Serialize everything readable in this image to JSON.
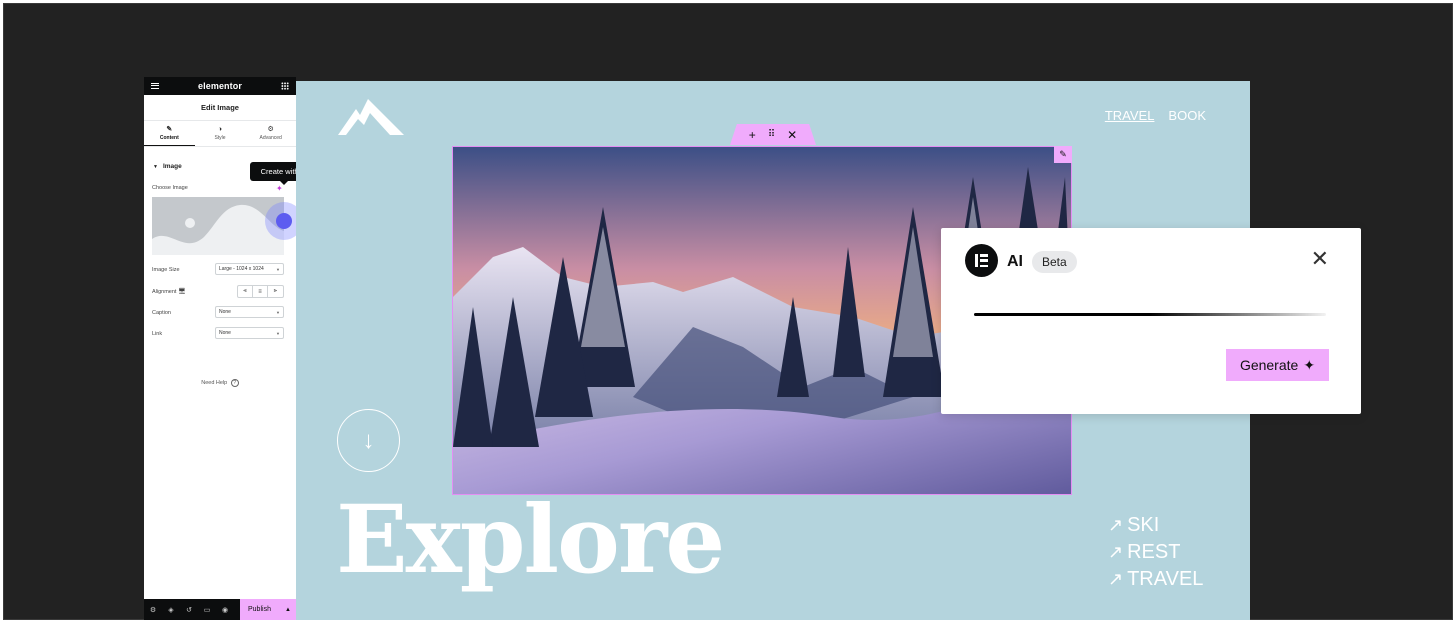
{
  "editor": {
    "brand": "elementor",
    "panel_title": "Edit Image",
    "tabs": [
      {
        "label": "Content",
        "icon": "pencil-icon"
      },
      {
        "label": "Style",
        "icon": "half-circle-icon"
      },
      {
        "label": "Advanced",
        "icon": "gear-icon"
      }
    ],
    "section_title": "Image",
    "choose_image_label": "Choose Image",
    "tooltip": "Create with AI",
    "image_size_label": "Image Size",
    "image_size_value": "Large - 1024 x 1024",
    "alignment_label": "Alignment",
    "caption_label": "Caption",
    "caption_value": "None",
    "link_label": "Link",
    "link_value": "None",
    "need_help": "Need Help",
    "publish_label": "Publish"
  },
  "site": {
    "nav": [
      "TRAVEL",
      "BOOK"
    ],
    "headline": "Explore",
    "links": [
      "SKI",
      "REST",
      "TRAVEL"
    ]
  },
  "ai_panel": {
    "title": "AI",
    "badge": "Beta",
    "generate_label": "Generate"
  },
  "colors": {
    "accent": "#f0abfc",
    "canvas_bg": "#b4d4dd",
    "editor_bg": "#222222",
    "cursor": "#5d5cf0"
  }
}
